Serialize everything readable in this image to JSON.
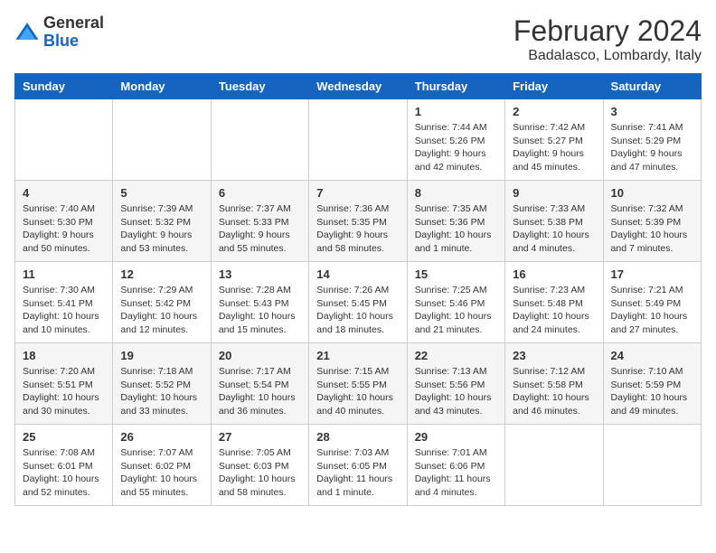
{
  "logo": {
    "general": "General",
    "blue": "Blue"
  },
  "header": {
    "month": "February 2024",
    "location": "Badalasco, Lombardy, Italy"
  },
  "days_of_week": [
    "Sunday",
    "Monday",
    "Tuesday",
    "Wednesday",
    "Thursday",
    "Friday",
    "Saturday"
  ],
  "weeks": [
    [
      {
        "day": "",
        "info": ""
      },
      {
        "day": "",
        "info": ""
      },
      {
        "day": "",
        "info": ""
      },
      {
        "day": "",
        "info": ""
      },
      {
        "day": "1",
        "info": "Sunrise: 7:44 AM\nSunset: 5:26 PM\nDaylight: 9 hours\nand 42 minutes."
      },
      {
        "day": "2",
        "info": "Sunrise: 7:42 AM\nSunset: 5:27 PM\nDaylight: 9 hours\nand 45 minutes."
      },
      {
        "day": "3",
        "info": "Sunrise: 7:41 AM\nSunset: 5:29 PM\nDaylight: 9 hours\nand 47 minutes."
      }
    ],
    [
      {
        "day": "4",
        "info": "Sunrise: 7:40 AM\nSunset: 5:30 PM\nDaylight: 9 hours\nand 50 minutes."
      },
      {
        "day": "5",
        "info": "Sunrise: 7:39 AM\nSunset: 5:32 PM\nDaylight: 9 hours\nand 53 minutes."
      },
      {
        "day": "6",
        "info": "Sunrise: 7:37 AM\nSunset: 5:33 PM\nDaylight: 9 hours\nand 55 minutes."
      },
      {
        "day": "7",
        "info": "Sunrise: 7:36 AM\nSunset: 5:35 PM\nDaylight: 9 hours\nand 58 minutes."
      },
      {
        "day": "8",
        "info": "Sunrise: 7:35 AM\nSunset: 5:36 PM\nDaylight: 10 hours\nand 1 minute."
      },
      {
        "day": "9",
        "info": "Sunrise: 7:33 AM\nSunset: 5:38 PM\nDaylight: 10 hours\nand 4 minutes."
      },
      {
        "day": "10",
        "info": "Sunrise: 7:32 AM\nSunset: 5:39 PM\nDaylight: 10 hours\nand 7 minutes."
      }
    ],
    [
      {
        "day": "11",
        "info": "Sunrise: 7:30 AM\nSunset: 5:41 PM\nDaylight: 10 hours\nand 10 minutes."
      },
      {
        "day": "12",
        "info": "Sunrise: 7:29 AM\nSunset: 5:42 PM\nDaylight: 10 hours\nand 12 minutes."
      },
      {
        "day": "13",
        "info": "Sunrise: 7:28 AM\nSunset: 5:43 PM\nDaylight: 10 hours\nand 15 minutes."
      },
      {
        "day": "14",
        "info": "Sunrise: 7:26 AM\nSunset: 5:45 PM\nDaylight: 10 hours\nand 18 minutes."
      },
      {
        "day": "15",
        "info": "Sunrise: 7:25 AM\nSunset: 5:46 PM\nDaylight: 10 hours\nand 21 minutes."
      },
      {
        "day": "16",
        "info": "Sunrise: 7:23 AM\nSunset: 5:48 PM\nDaylight: 10 hours\nand 24 minutes."
      },
      {
        "day": "17",
        "info": "Sunrise: 7:21 AM\nSunset: 5:49 PM\nDaylight: 10 hours\nand 27 minutes."
      }
    ],
    [
      {
        "day": "18",
        "info": "Sunrise: 7:20 AM\nSunset: 5:51 PM\nDaylight: 10 hours\nand 30 minutes."
      },
      {
        "day": "19",
        "info": "Sunrise: 7:18 AM\nSunset: 5:52 PM\nDaylight: 10 hours\nand 33 minutes."
      },
      {
        "day": "20",
        "info": "Sunrise: 7:17 AM\nSunset: 5:54 PM\nDaylight: 10 hours\nand 36 minutes."
      },
      {
        "day": "21",
        "info": "Sunrise: 7:15 AM\nSunset: 5:55 PM\nDaylight: 10 hours\nand 40 minutes."
      },
      {
        "day": "22",
        "info": "Sunrise: 7:13 AM\nSunset: 5:56 PM\nDaylight: 10 hours\nand 43 minutes."
      },
      {
        "day": "23",
        "info": "Sunrise: 7:12 AM\nSunset: 5:58 PM\nDaylight: 10 hours\nand 46 minutes."
      },
      {
        "day": "24",
        "info": "Sunrise: 7:10 AM\nSunset: 5:59 PM\nDaylight: 10 hours\nand 49 minutes."
      }
    ],
    [
      {
        "day": "25",
        "info": "Sunrise: 7:08 AM\nSunset: 6:01 PM\nDaylight: 10 hours\nand 52 minutes."
      },
      {
        "day": "26",
        "info": "Sunrise: 7:07 AM\nSunset: 6:02 PM\nDaylight: 10 hours\nand 55 minutes."
      },
      {
        "day": "27",
        "info": "Sunrise: 7:05 AM\nSunset: 6:03 PM\nDaylight: 10 hours\nand 58 minutes."
      },
      {
        "day": "28",
        "info": "Sunrise: 7:03 AM\nSunset: 6:05 PM\nDaylight: 11 hours\nand 1 minute."
      },
      {
        "day": "29",
        "info": "Sunrise: 7:01 AM\nSunset: 6:06 PM\nDaylight: 11 hours\nand 4 minutes."
      },
      {
        "day": "",
        "info": ""
      },
      {
        "day": "",
        "info": ""
      }
    ]
  ]
}
